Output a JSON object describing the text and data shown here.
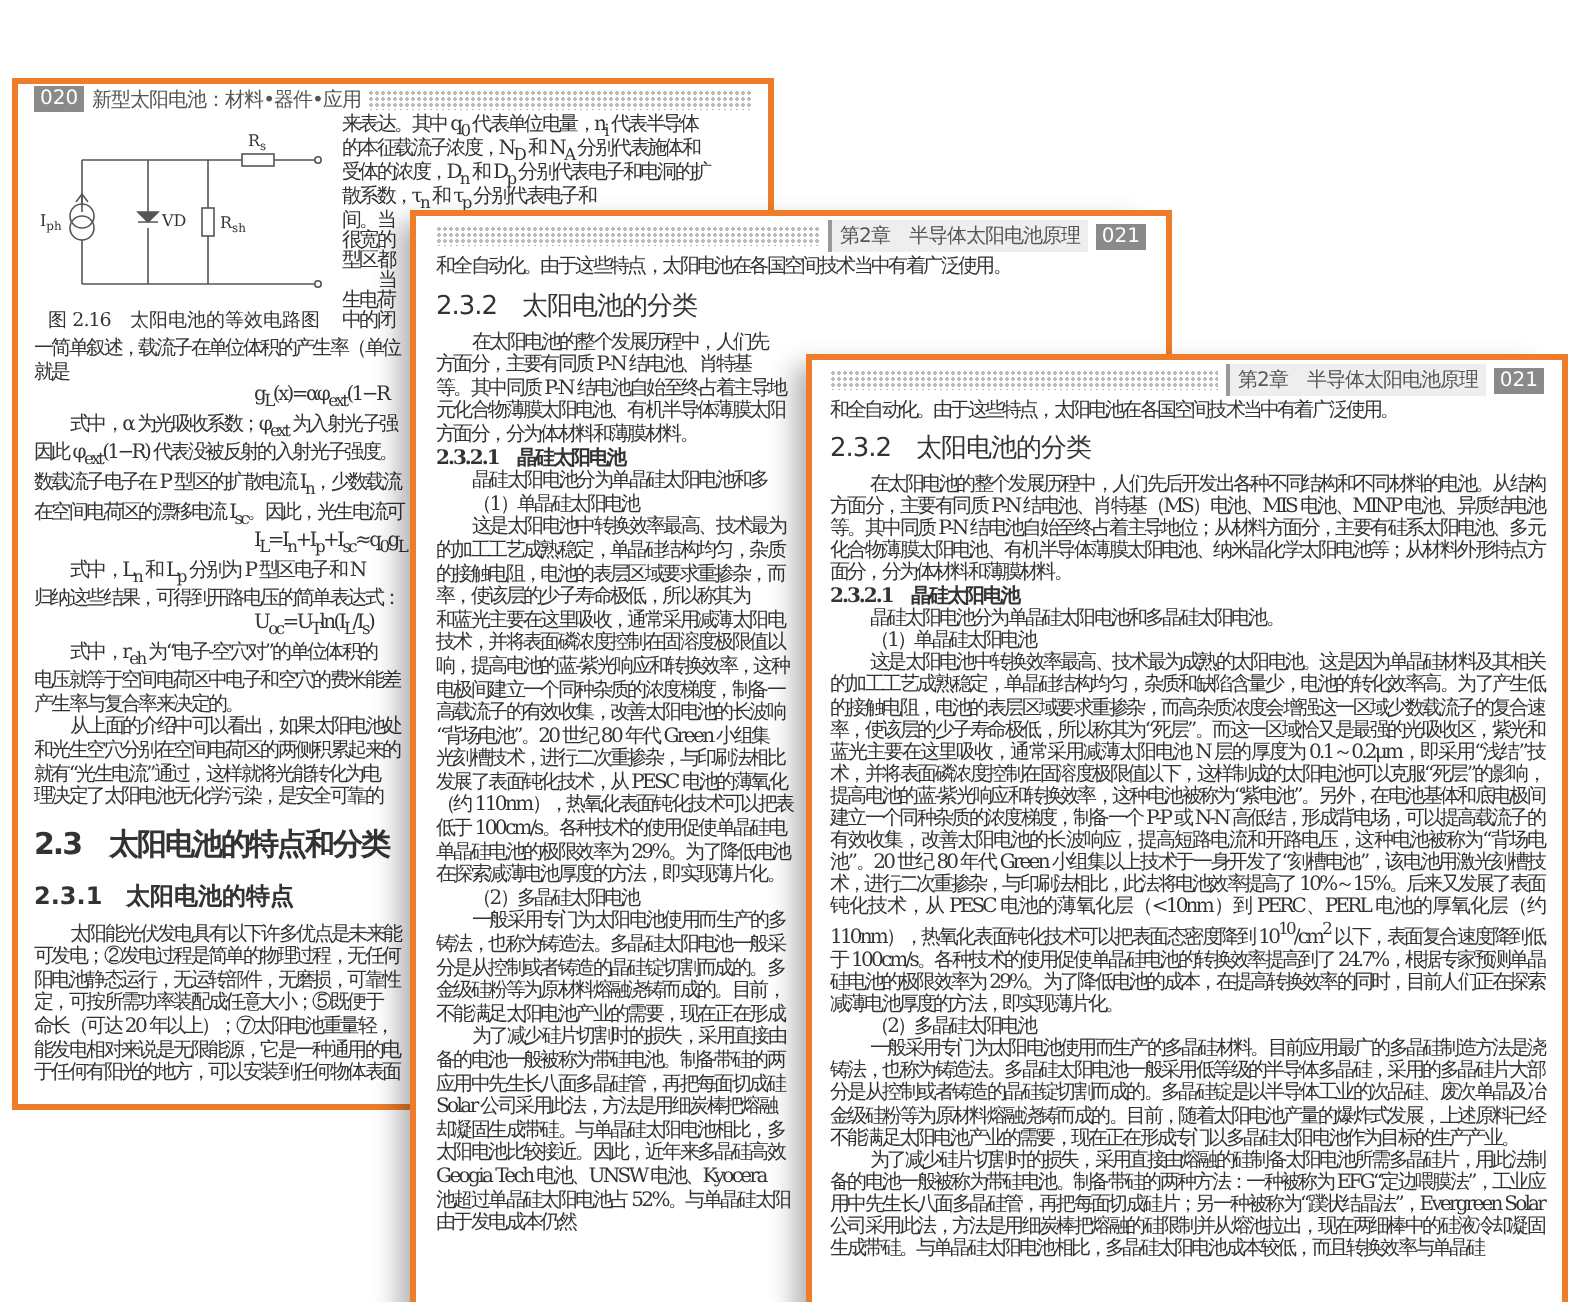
{
  "back_page": {
    "page_number": "020",
    "running_title": "新型太阳电池：材料•器件•应用",
    "diagram": {
      "labels": [
        {
          "symbol": "I",
          "subscript": "ph"
        },
        {
          "symbol": "VD"
        },
        {
          "symbol": "R",
          "subscript": "sh"
        },
        {
          "symbol": "R",
          "subscript": "s"
        }
      ],
      "caption": "图 2.16　太阳电池的等效电路图"
    },
    "side_lines": [
      {
        "kind": "line",
        "text": "来表达。其中 q$_{0}$ 代表单位电量，n$_{i}$ 代表半导体"
      },
      {
        "kind": "line",
        "text": "的本征载流子浓度，N$_{D}$ 和 N$_{A}$ 分别代表施体和"
      },
      {
        "kind": "line",
        "text": "受体的浓度，D$_{n}$ 和 D$_{p}$ 分别代表电子和电洞的扩"
      },
      {
        "kind": "line",
        "text": "散系数，τ$_{n}$ 和 τ$_{p}$ 分别代表电子和"
      },
      {
        "kind": "line",
        "text": "间。当"
      },
      {
        "kind": "line",
        "text": "很宽的"
      },
      {
        "kind": "line",
        "text": "型区都"
      },
      {
        "kind": "para",
        "text": "当"
      },
      {
        "kind": "line",
        "text": "生电荷"
      },
      {
        "kind": "line",
        "text": "中的闭"
      }
    ],
    "lines": [
      {
        "kind": "line",
        "text": "一简单叙述，载流子在单位体积的产生率（单位"
      },
      {
        "kind": "line",
        "text": "就是"
      },
      {
        "kind": "formula",
        "text": "g$_{L}$(x)=αφ$_{ext}$(1−R"
      },
      {
        "kind": "para",
        "text": "式中，α 为光吸收系数；φ$_{ext}$ 为入射光子强"
      },
      {
        "kind": "line",
        "text": "因此 φ$_{ext}$(1−R) 代表没被反射的入射光子强度。"
      },
      {
        "kind": "line",
        "text": "数载流子电子在 P 型区的扩散电流 I$_{n}$，少数载流"
      },
      {
        "kind": "line",
        "text": "在空间电荷区的漂移电流 I$_{sc}$。因此，光生电流可"
      },
      {
        "kind": "formula",
        "text": "I$_{L}$=I$_{n}$+I$_{p}$+I$_{sc}$≈q$_{0}$g$_{L}$"
      },
      {
        "kind": "para",
        "text": "式中，L$_{n}$ 和 L$_{p}$ 分别为 P 型区电子和 N"
      },
      {
        "kind": "line",
        "text": "归纳这些结果，可得到开路电压的简单表达式："
      },
      {
        "kind": "formula",
        "text": "U$_{oc}$=U$_{T}$ln(I$_{L}$/I$_{s}$)"
      },
      {
        "kind": "para",
        "text": "式中，r$_{eh}$ 为“电子-空穴对”的单位体积的"
      },
      {
        "kind": "line",
        "text": "电压就等于空间电荷区中电子和空穴的费米能差"
      },
      {
        "kind": "line",
        "text": "产生率与复合率来决定的。"
      },
      {
        "kind": "para",
        "text": "从上面的介绍中可以看出，如果太阳电池处"
      },
      {
        "kind": "line",
        "text": "和光生空穴分别在空间电荷区的两侧积累起来的"
      },
      {
        "kind": "line",
        "text": "就有“光生电流”通过，这样就将光能转化为电"
      },
      {
        "kind": "line",
        "text": "理决定了太阳电池无化学污染，是安全可靠的"
      },
      {
        "kind": "heading",
        "text": "2.3　太阳电池的特点和分类"
      },
      {
        "kind": "subheading",
        "text": "2.3.1　太阳电池的特点"
      },
      {
        "kind": "para",
        "text": "太阳能光伏发电具有以下许多优点是未来能"
      },
      {
        "kind": "line",
        "text": "可发电；②发电过程是简单的物理过程，无任何"
      },
      {
        "kind": "line",
        "text": "阳电池静态运行，无运转部件，无磨损，可靠性"
      },
      {
        "kind": "line",
        "text": "定，可按所需功率装配成任意大小；⑤既便于"
      },
      {
        "kind": "line",
        "text": "命长（可达 20 年以上）；⑦太阳电池重量轻，"
      },
      {
        "kind": "line",
        "text": "能发电相对来说是无限能源，它是一种通用的电"
      },
      {
        "kind": "line",
        "text": "于任何有阳光的地方，可以安装到任何物体表面"
      }
    ]
  },
  "middle_page": {
    "chapter": "第2章　半导体太阳电池原理",
    "page_number": "021",
    "lines": [
      {
        "kind": "line",
        "text": "和全自动化。由于这些特点，太阳电池在各国空间技术当中有着广泛使用。"
      },
      {
        "kind": "heading",
        "text": "2.3.2　太阳电池的分类"
      },
      {
        "kind": "para",
        "text": "在太阳电池的整个发展历程中，人们先"
      },
      {
        "kind": "line",
        "text": "方面分，主要有同质 P-N 结电池、肖特基"
      },
      {
        "kind": "line",
        "text": "等。其中同质 P-N 结电池自始至终占着主导地"
      },
      {
        "kind": "line",
        "text": "元化合物薄膜太阳电池、有机半导体薄膜太阳"
      },
      {
        "kind": "line",
        "text": "方面分，分为体材料和薄膜材料。"
      },
      {
        "kind": "subheading",
        "text": "2.3.2.1　晶硅太阳电池"
      },
      {
        "kind": "para",
        "text": "晶硅太阳电池分为单晶硅太阳电池和多"
      },
      {
        "kind": "para",
        "text": "（1）单晶硅太阳电池"
      },
      {
        "kind": "para",
        "text": "这是太阳电池中转换效率最高、技术最为"
      },
      {
        "kind": "line",
        "text": "的加工工艺成熟稳定，单晶硅结构均匀，杂质"
      },
      {
        "kind": "line",
        "text": "的接触电阻，电池的表层区域要求重掺杂，而"
      },
      {
        "kind": "line",
        "text": "率，使该层的少子寿命极低，所以称其为"
      },
      {
        "kind": "line",
        "text": "和蓝光主要在这里吸收，通常采用减薄太阳电"
      },
      {
        "kind": "line",
        "text": "技术，并将表面磷浓度控制在固溶度极限值以"
      },
      {
        "kind": "line",
        "text": "响，提高电池的蓝-紫光响应和转换效率，这种"
      },
      {
        "kind": "line",
        "text": "电极间建立一个同种杂质的浓度梯度，制备一"
      },
      {
        "kind": "line",
        "text": "高载流子的有效收集，改善太阳电池的长波响"
      },
      {
        "kind": "line",
        "text": "“背场电池”。20 世纪 80 年代 Green 小组集"
      },
      {
        "kind": "line",
        "text": "光刻槽技术，进行二次重掺杂，与印刷法相比"
      },
      {
        "kind": "line",
        "text": "发展了表面钝化技术，从 PESC 电池的薄氧化"
      },
      {
        "kind": "line",
        "text": "（约 110nm），热氧化表面钝化技术可以把表"
      },
      {
        "kind": "line",
        "text": "低于 100cm/s。各种技术的使用促使单晶硅电"
      },
      {
        "kind": "line",
        "text": "单晶硅电池的极限效率为 29%。为了降低电池"
      },
      {
        "kind": "line",
        "text": "在探索减薄电池厚度的方法，即实现薄片化。"
      },
      {
        "kind": "para",
        "text": "（2）多晶硅太阳电池"
      },
      {
        "kind": "para",
        "text": "一般采用专门为太阳电池使用而生产的多"
      },
      {
        "kind": "line",
        "text": "铸法，也称为铸造法。多晶硅太阳电池一般采"
      },
      {
        "kind": "line",
        "text": "分是从控制或者铸造的晶硅锭切割而成的。多"
      },
      {
        "kind": "line",
        "text": "金级硅粉等为原材料熔融浇铸而成的。目前，"
      },
      {
        "kind": "line",
        "text": "不能满足太阳电池产业的需要，现在正在形成"
      },
      {
        "kind": "para",
        "text": "为了减少硅片切割时的损失，采用直接由"
      },
      {
        "kind": "line",
        "text": "备的电池一般被称为带硅电池。制备带硅的两"
      },
      {
        "kind": "line",
        "text": "应用中先生长八面多晶硅管，再把每面切成硅"
      },
      {
        "kind": "line",
        "text": "Solar 公司采用此法，方法是用细炭棒把熔融"
      },
      {
        "kind": "line",
        "text": "却凝固生成带硅。与单晶硅太阳电池相比，多"
      },
      {
        "kind": "line",
        "text": "太阳电池比较接近。因此，近年来多晶硅高效"
      },
      {
        "kind": "line",
        "text": "Geogia Tech 电池、UNSW 电池、Kyocera"
      },
      {
        "kind": "line",
        "text": "池超过单晶硅太阳电池占 52%。与单晶硅太阳"
      },
      {
        "kind": "line",
        "text": "由于发电成本仍然"
      }
    ]
  },
  "front_page": {
    "chapter": "第2章　半导体太阳电池原理",
    "page_number": "021",
    "blocks": [
      {
        "kind": "line",
        "text": "和全自动化。由于这些特点，太阳电池在各国空间技术当中有着广泛使用。"
      },
      {
        "kind": "heading",
        "text": "2.3.2　太阳电池的分类"
      },
      {
        "kind": "para",
        "text": "在太阳电池的整个发展历程中，人们先后开发出各种不同结构和不同材料的电池。从结构方面分，主要有同质 P-N 结电池、肖特基（MS）电池、MIS 电池、MINP 电池、异质结电池等。其中同质 P-N 结电池自始至终占着主导地位；从材料方面分，主要有硅系太阳电池、多元化合物薄膜太阳电池、有机半导体薄膜太阳电池、纳米晶化学太阳电池等；从材料外形特点方面分，分为体材料和薄膜材料。"
      },
      {
        "kind": "subheading",
        "text": "2.3.2.1　晶硅太阳电池"
      },
      {
        "kind": "para",
        "text": "晶硅太阳电池分为单晶硅太阳电池和多晶硅太阳电池。"
      },
      {
        "kind": "para",
        "text": "（1）单晶硅太阳电池"
      },
      {
        "kind": "para",
        "text": "这是太阳电池中转换效率最高、技术最为成熟的太阳电池。这是因为单晶硅材料及其相关的加工工艺成熟稳定，单晶硅结构均匀，杂质和缺陷含量少，电池的转化效率高。为了产生低的接触电阻，电池的表层区域要求重掺杂，而高杂质浓度会增强这一区域少数载流子的复合速率，使该层的少子寿命极低，所以称其为“死层”。而这一区域恰又是最强的光吸收区，紫光和蓝光主要在这里吸收，通常采用减薄太阳电池 N 层的厚度为 0.1～0.2μm，即采用“浅结”技术，并将表面磷浓度控制在固溶度极限值以下，这样制成的太阳电池可以克服“死层”的影响，提高电池的蓝-紫光响应和转换效率，这种电池被称为“紫电池”。另外，在电池基体和底电极间建立一个同种杂质的浓度梯度，制备一个 P-P 或 N-N 高低结，形成背电场，可以提高载流子的有效收集，改善太阳电池的长波响应，提高短路电流和开路电压，这种电池被称为“背场电池”。20 世纪 80 年代 Green 小组集以上技术于一身开发了“刻槽电池”，该电池用激光刻槽技术，进行二次重掺杂，与印刷法相比，此法将电池效率提高了 10%～15%。后来又发展了表面钝化技术，从 PESC 电池的薄氧化层（<10nm）到 PERC、PERL 电池的厚氧化层（约 110nm），热氧化表面钝化技术可以把表面态密度降到 10$^{10}$/cm$^{2}$ 以下，表面复合速度降到低于 100cm/s。各种技术的使用促使单晶硅电池的转换效率提高到了 24.7%，根据专家预测单晶硅电池的极限效率为 29%。为了降低电池的成本，在提高转换效率的同时，目前人们正在探索减薄电池厚度的方法，即实现薄片化。"
      },
      {
        "kind": "para",
        "text": "（2）多晶硅太阳电池"
      },
      {
        "kind": "para",
        "text": "一般采用专门为太阳电池使用而生产的多晶硅材料。目前应用最广的多晶硅制造方法是浇铸法，也称为铸造法。多晶硅太阳电池一般采用低等级的半导体多晶硅，采用的多晶硅片大部分是从控制或者铸造的晶硅锭切割而成的。多晶硅锭是以半导体工业的次品硅、废次单晶及冶金级硅粉等为原材料熔融浇铸而成的。目前，随着太阳电池产量的爆炸式发展，上述原料已经不能满足太阳电池产业的需要，现在正在形成专门以多晶硅太阳电池作为目标的生产产业。"
      },
      {
        "kind": "para",
        "text": "为了减少硅片切割时的损失，采用直接由熔融的硅制备太阳电池所需多晶硅片，用此法制备的电池一般被称为带硅电池。制备带硅的两种方法：一种被称为 EFG“定边喂膜法”，工业应用中先生长八面多晶硅管，再把每面切成硅片；另一种被称为“蹼状结晶法”，Evergreen Solar 公司采用此法，方法是用细炭棒把熔融的硅限制并从熔池拉出，现在两细棒中的硅液冷却凝固生成带硅。与单晶硅太阳电池相比，多晶硅太阳电池成本较低，而且转换效率与单晶硅"
      }
    ]
  }
}
